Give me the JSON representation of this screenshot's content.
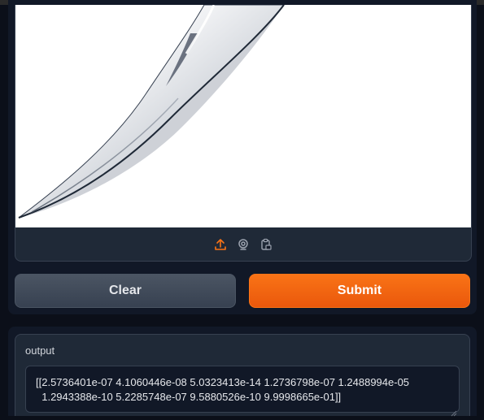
{
  "input": {
    "image_alt": "knife blade",
    "upload_icon": "upload-icon",
    "webcam_icon": "webcam-icon",
    "clipboard_icon": "clipboard-icon",
    "accent_color": "#f97316"
  },
  "buttons": {
    "clear_label": "Clear",
    "submit_label": "Submit"
  },
  "output": {
    "label": "output",
    "value": "[[2.5736401e-07 4.1060446e-08 5.0323413e-14 1.2736798e-07 1.2488994e-05\n  1.2943388e-10 5.2285748e-07 9.5880526e-10 9.9998665e-01]]"
  }
}
